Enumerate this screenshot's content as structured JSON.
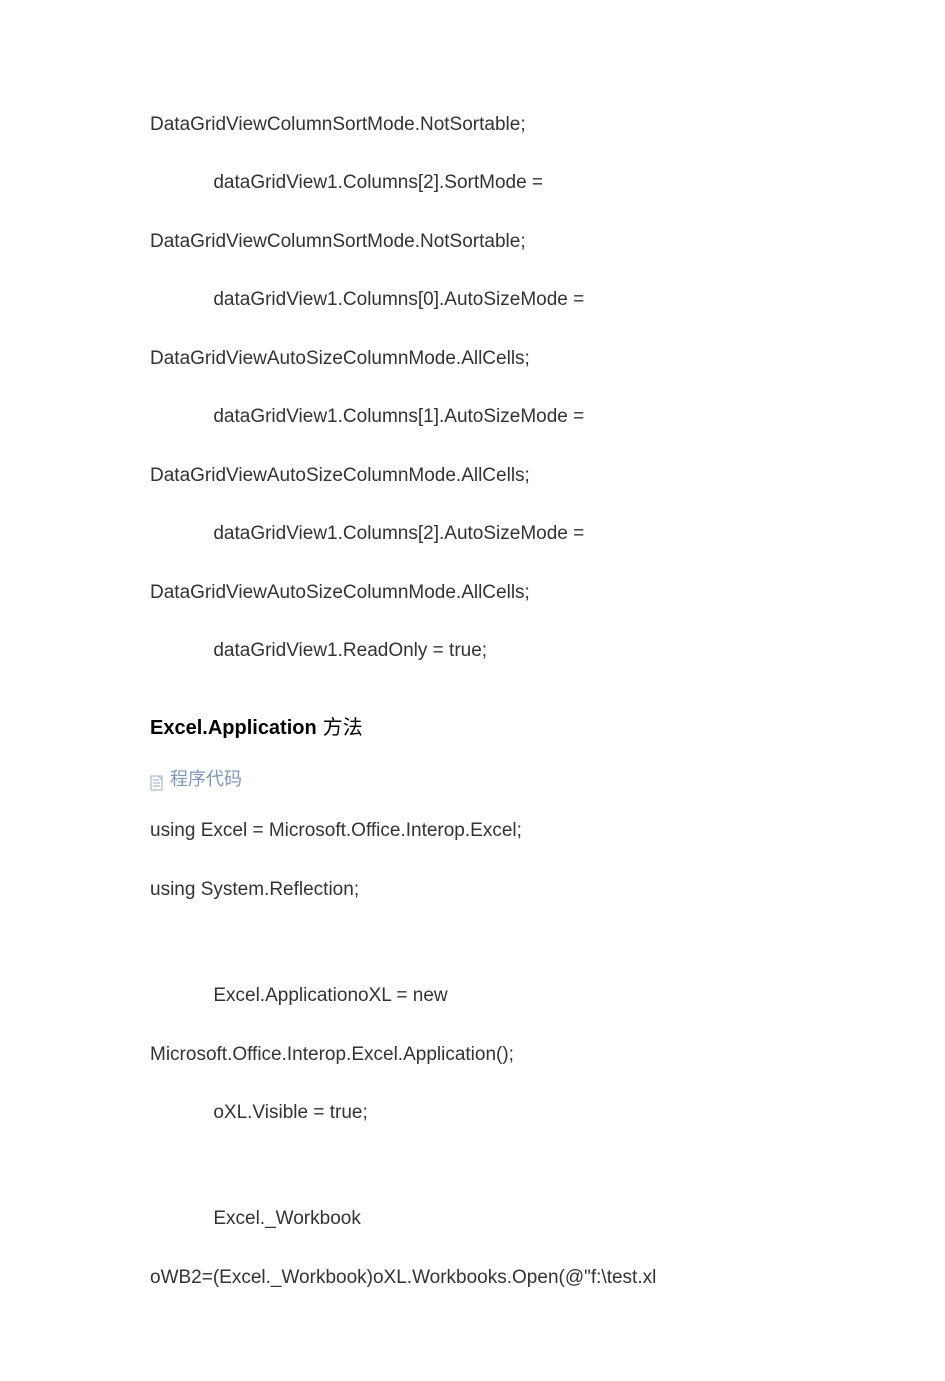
{
  "lines": [
    {
      "indent": 0,
      "text": "DataGridViewColumnSortMode.NotSortable;"
    },
    {
      "indent": 1,
      "text": "dataGridView1.Columns[2].SortMode ="
    },
    {
      "indent": 0,
      "text": "DataGridViewColumnSortMode.NotSortable;"
    },
    {
      "indent": 1,
      "text": "dataGridView1.Columns[0].AutoSizeMode ="
    },
    {
      "indent": 0,
      "text": "DataGridViewAutoSizeColumnMode.AllCells;"
    },
    {
      "indent": 1,
      "text": "dataGridView1.Columns[1].AutoSizeMode ="
    },
    {
      "indent": 0,
      "text": "DataGridViewAutoSizeColumnMode.AllCells;"
    },
    {
      "indent": 1,
      "text": "dataGridView1.Columns[2].AutoSizeMode ="
    },
    {
      "indent": 0,
      "text": "DataGridViewAutoSizeColumnMode.AllCells;"
    },
    {
      "indent": 1,
      "text": "dataGridView1.ReadOnly = true;"
    }
  ],
  "heading": {
    "bold": "Excel.Application",
    "cn": "方法"
  },
  "caption": "程序代码",
  "lines2": [
    {
      "indent": 0,
      "text": "using Excel = Microsoft.Office.Interop.Excel;"
    },
    {
      "indent": 0,
      "text": "using System.Reflection;"
    },
    {
      "indent": 0,
      "blank": true
    },
    {
      "indent": 1,
      "text": "Excel.ApplicationoXL = new"
    },
    {
      "indent": 0,
      "text": "Microsoft.Office.Interop.Excel.Application();"
    },
    {
      "indent": 1,
      "text": "oXL.Visible = true;"
    },
    {
      "indent": 0,
      "blank": true
    },
    {
      "indent": 1,
      "text": "Excel._Workbook"
    },
    {
      "indent": 0,
      "text": "oWB2=(Excel._Workbook)oXL.Workbooks.Open(@\"f:\\test.xl"
    }
  ],
  "indentSpaces": "            "
}
